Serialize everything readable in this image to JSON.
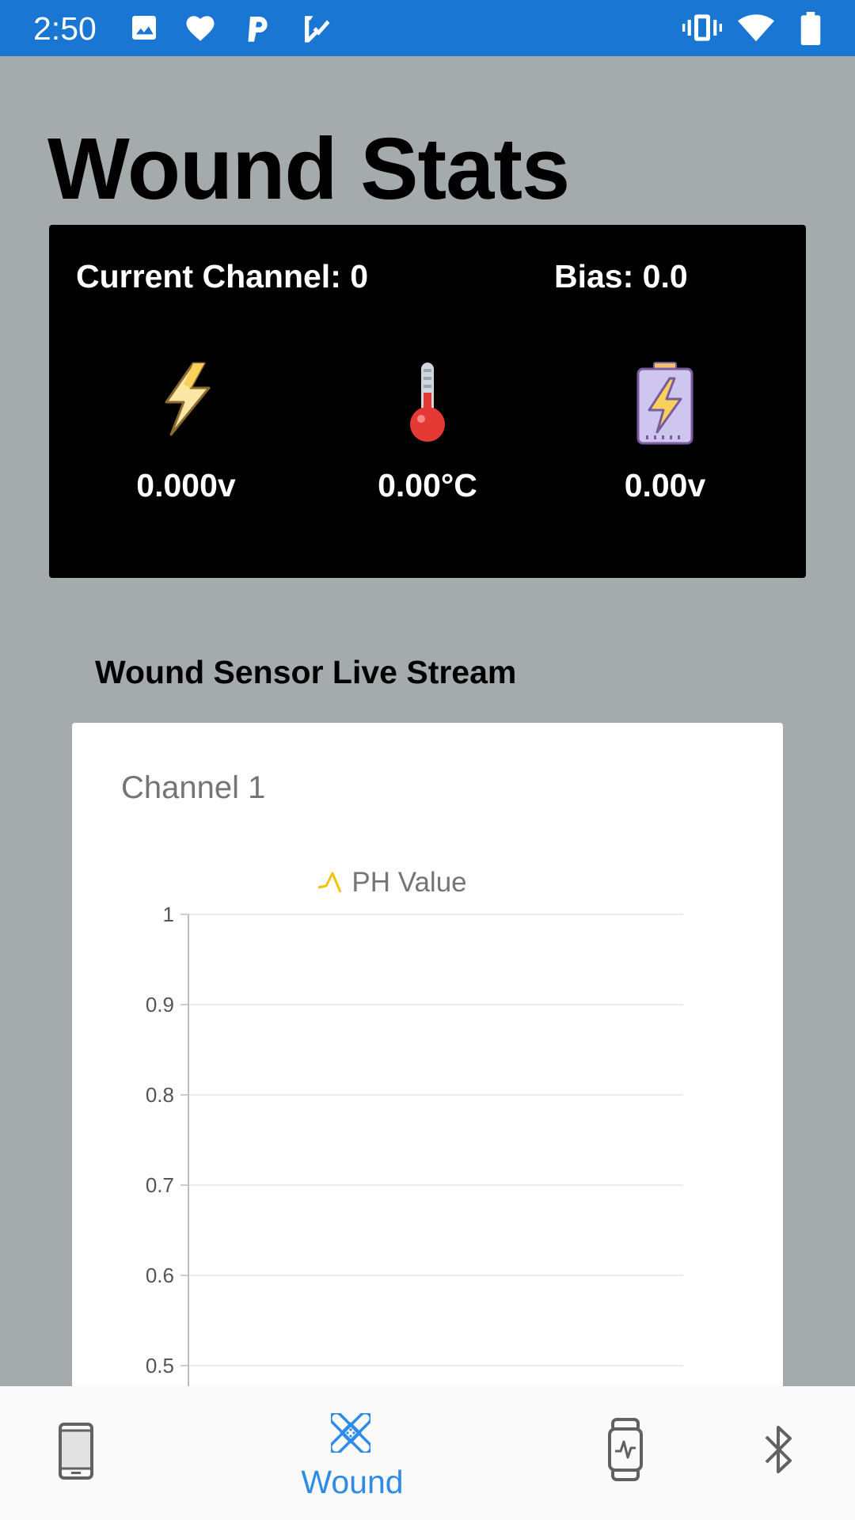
{
  "status_bar": {
    "time": "2:50",
    "left_icons": [
      "image-icon",
      "heart-icon",
      "p-icon",
      "checkbox-icon"
    ],
    "right_icons": [
      "vibrate-icon",
      "wifi-icon",
      "battery-icon"
    ]
  },
  "header": {
    "title": "Wound Stats"
  },
  "stats": {
    "channel_label": "Current Channel: 0",
    "bias_label": "Bias: 0.0",
    "voltage": "0.000v",
    "temperature": "0.00°C",
    "battery": "0.00v",
    "icons": [
      "lightning-icon",
      "thermometer-icon",
      "battery-charging-icon"
    ]
  },
  "live_stream": {
    "title": "Wound Sensor Live Stream",
    "chart_title": "Channel 1"
  },
  "chart_data": {
    "type": "line",
    "series": [
      {
        "name": "PH Value",
        "values": []
      }
    ],
    "y_tick_labels": [
      "1",
      "0.9",
      "0.8",
      "0.7",
      "0.6",
      "0.5"
    ],
    "ylim": [
      0.5,
      1
    ],
    "grid": true,
    "legend": "top-center",
    "colors": {
      "series": "#f4c20d",
      "grid": "#e6e6e6",
      "axis": "#bdbdbd",
      "tick_text": "#555555"
    }
  },
  "nav": {
    "items": [
      {
        "icon": "phone-icon",
        "label": ""
      },
      {
        "icon": "bandage-icon",
        "label": "Wound",
        "active": true
      },
      {
        "icon": "smartwatch-icon",
        "label": ""
      },
      {
        "icon": "bluetooth-icon",
        "label": ""
      }
    ],
    "active_label": "Wound",
    "active_color": "#2e8be8",
    "inactive_color": "#616161"
  }
}
